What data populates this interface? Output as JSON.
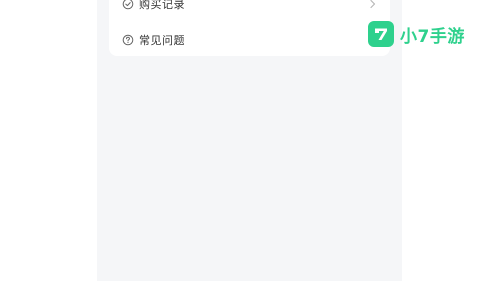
{
  "menu": {
    "items": [
      {
        "label": "购买记录",
        "icon": "check-circle-icon",
        "has_chevron": true
      },
      {
        "label": "常见问题",
        "icon": "question-circle-icon",
        "has_chevron": false
      }
    ]
  },
  "watermark": {
    "badge_glyph": "7",
    "text": "小7手游",
    "color": "#2ed18d"
  },
  "colors": {
    "screen_bg": "#f5f6f8",
    "card_bg": "#ffffff",
    "text": "#333333",
    "icon": "#666666",
    "chevron": "#b5b5b5"
  }
}
